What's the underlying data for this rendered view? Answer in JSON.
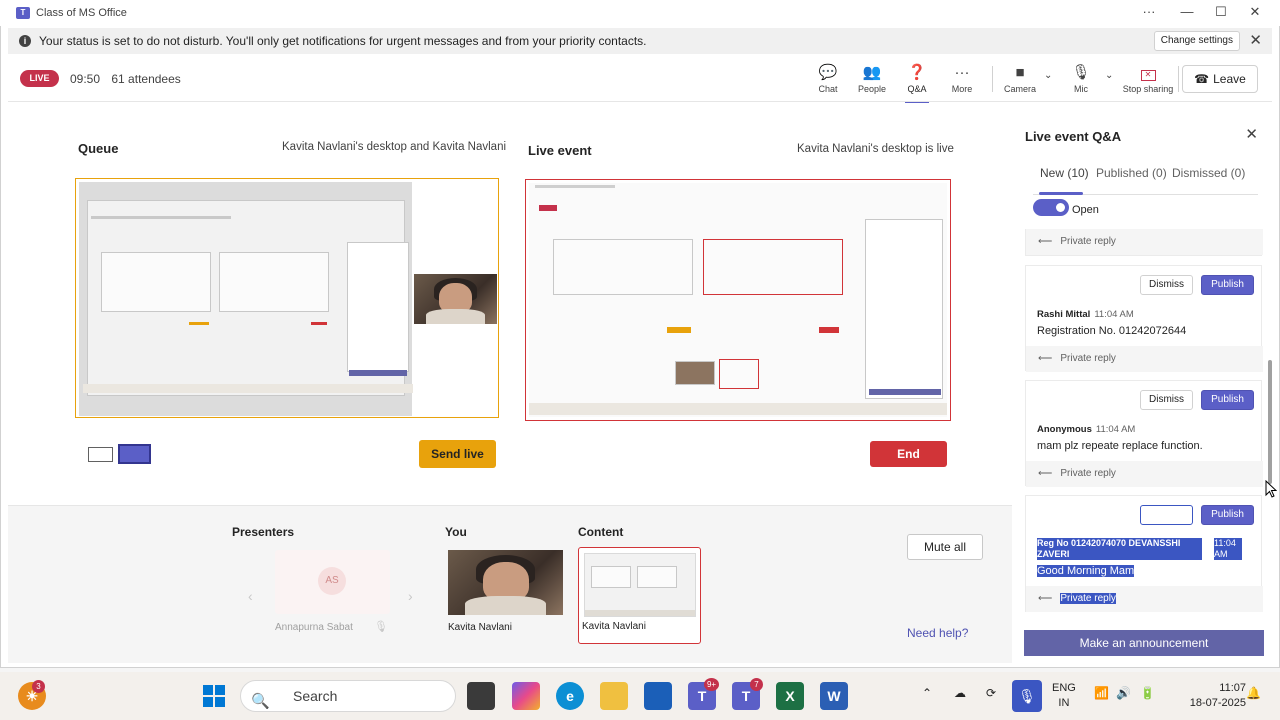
{
  "titlebar": {
    "title": "Class of MS Office",
    "logo": "T",
    "more": "···",
    "minimize": "—",
    "maximize": "☐",
    "close": "✕"
  },
  "banner": {
    "message": "Your status is set to do not disturb. You'll only get notifications for urgent messages and from your priority contacts.",
    "change_label": "Change settings",
    "close": "✕"
  },
  "meeting": {
    "live_label": "LIVE",
    "time": "09:50",
    "attendees": "61 attendees",
    "toolbar": {
      "chat": "Chat",
      "people": "People",
      "qa": "Q&A",
      "more": "More",
      "camera": "Camera",
      "mic": "Mic",
      "stop_sharing": "Stop sharing",
      "leave": "Leave"
    }
  },
  "queue": {
    "title": "Queue",
    "subtitle": "Kavita Navlani's desktop and Kavita Navlani",
    "send_live": "Send live"
  },
  "live_event": {
    "title": "Live event",
    "subtitle": "Kavita Navlani's desktop is live",
    "end": "End"
  },
  "bottom": {
    "presenters_title": "Presenters",
    "presenter_initials": "AS",
    "presenter_name": "Annapurna Sabat",
    "you_title": "You",
    "you_name": "Kavita Navlani",
    "content_title": "Content",
    "content_name": "Kavita Navlani",
    "mute_all": "Mute all",
    "need_help": "Need help?"
  },
  "qa_panel": {
    "title": "Live event Q&A",
    "tabs": [
      {
        "label": "New (10)"
      },
      {
        "label": "Published (0)"
      },
      {
        "label": "Dismissed (0)"
      }
    ],
    "toggle_label": "Open",
    "private_reply": "Private reply",
    "dismiss": "Dismiss",
    "publish": "Publish",
    "questions": [
      {
        "name": "Rashi Mittal",
        "time": "11:04 AM",
        "text": "Registration No. 01242072644"
      },
      {
        "name": "Anonymous",
        "time": "11:04 AM",
        "text": "mam plz repeate replace function."
      },
      {
        "name": "Reg No 01242074070 DEVANSSHI ZAVERI",
        "time": "11:04 AM",
        "text": "Good Morning Mam"
      }
    ],
    "announce": "Make an announcement"
  },
  "taskbar": {
    "search": "Search",
    "teams_badge_1": "9+",
    "teams_badge_2": "7",
    "weather_badge": "3",
    "lang_1": "ENG",
    "lang_2": "IN",
    "time": "11:07",
    "date": "18-07-2025"
  },
  "colors": {
    "accent": "#5b5fc7",
    "live": "#c4314b",
    "send_live": "#e8a20c",
    "end": "#d13438"
  }
}
